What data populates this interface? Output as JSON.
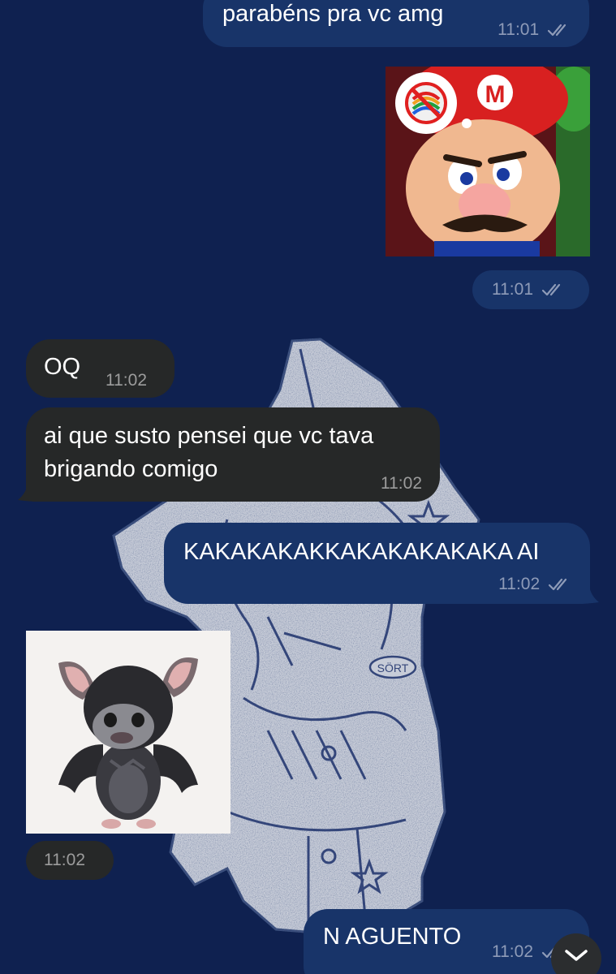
{
  "messages": [
    {
      "text": "parabéns pra vc amg",
      "time": "11:01",
      "direction": "outgoing"
    },
    {
      "sticker": "mario-no-rainbow",
      "time": "11:01",
      "direction": "outgoing"
    },
    {
      "text": "OQ",
      "time": "11:02",
      "direction": "incoming"
    },
    {
      "text_line1": "ai que susto pensei que vc tava",
      "text_line2": "brigando comigo",
      "time": "11:02",
      "direction": "incoming"
    },
    {
      "text": "KAKAKAKAKKAKAKAKAKAKA AI",
      "time": "11:02",
      "direction": "outgoing"
    },
    {
      "sticker": "sad-bat",
      "time": "11:02",
      "direction": "incoming"
    },
    {
      "text": "N AGUENTO",
      "time": "11:02",
      "direction": "outgoing"
    }
  ],
  "icons": {
    "read_receipt": "double-check-icon",
    "scroll_down": "chevron-down-icon",
    "wallpaper_sticker_badge": "SÖRT"
  },
  "colors": {
    "background": "#0f2150",
    "outgoing_bubble": "#183469",
    "incoming_bubble": "#262828",
    "time_text": "#8e9bb8"
  }
}
